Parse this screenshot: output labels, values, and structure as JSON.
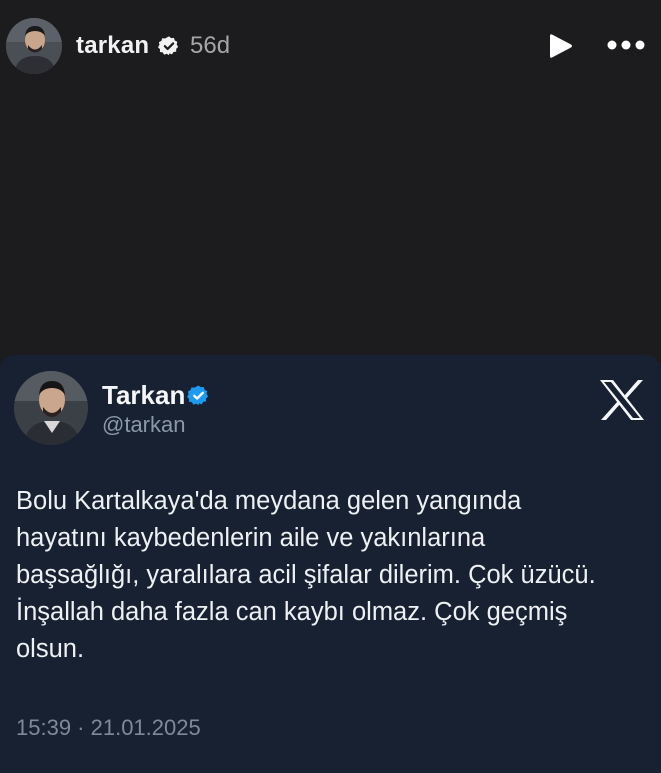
{
  "story": {
    "username": "tarkan",
    "time_ago": "56d",
    "avatar_icon": "profile-photo",
    "verified_icon": "verified-badge-icon",
    "play_icon": "play-icon",
    "more_icon": "more-horizontal-icon"
  },
  "tweet": {
    "display_name": "Tarkan",
    "handle": "@tarkan",
    "verified_color": "#1d9bf0",
    "platform_icon": "x-logo-icon",
    "text": "Bolu Kartalkaya'da meydana gelen yangında\nhayatını kaybedenlerin aile ve yakınlarına\nbaşsağlığı, yaralılara acil şifalar dilerim. Çok üzücü.\nİnşallah daha fazla can kaybı olmaz. Çok geçmiş\nolsun.",
    "timestamp": "15:39 · 21.01.2025"
  },
  "colors": {
    "story_background": "#1c1b1d",
    "card_background": "#172131",
    "secondary_text": "#8b98a5"
  }
}
